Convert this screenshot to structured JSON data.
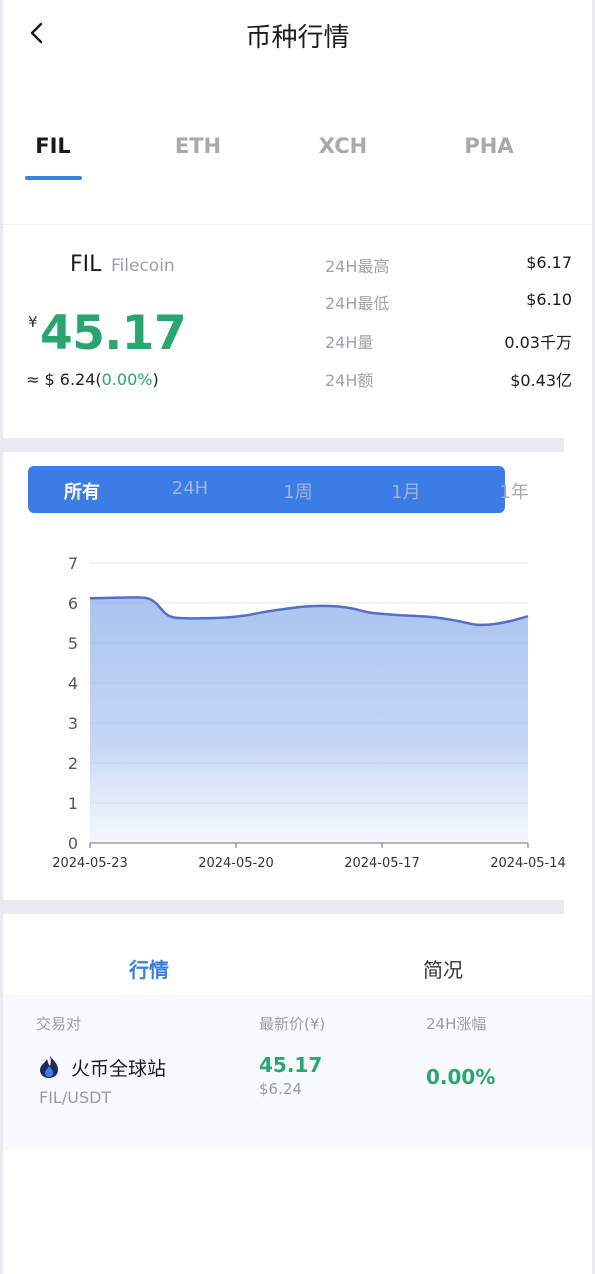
{
  "header": {
    "title": "币种行情"
  },
  "coin_tabs": [
    {
      "label": "FIL",
      "active": true
    },
    {
      "label": "ETH",
      "active": false
    },
    {
      "label": "XCH",
      "active": false
    },
    {
      "label": "PHA",
      "active": false
    }
  ],
  "coin": {
    "symbol": "FIL",
    "name": "Filecoin",
    "currency_mark": "¥",
    "price_cny": "45.17",
    "usd_prefix": "≈ $ 6.24(",
    "usd_change": "0.00%",
    "usd_suffix": ")"
  },
  "stats": [
    {
      "label": "24H最高",
      "value": "$6.17"
    },
    {
      "label": "24H最低",
      "value": "$6.10"
    },
    {
      "label": "24H量",
      "value": "0.03千万"
    },
    {
      "label": "24H额",
      "value": "$0.43亿"
    }
  ],
  "range_tabs": [
    {
      "label": "所有",
      "active": true
    },
    {
      "label": "24H",
      "active": false
    },
    {
      "label": "1周",
      "active": false
    },
    {
      "label": "1月",
      "active": false
    },
    {
      "label": "1年",
      "active": false
    }
  ],
  "chart_data": {
    "type": "area",
    "x": [
      "2024-05-23",
      "2024-05-20",
      "2024-05-17",
      "2024-05-14"
    ],
    "y_ticks": [
      0,
      1,
      2,
      3,
      4,
      5,
      6,
      7
    ],
    "ylim": [
      0,
      7
    ],
    "series": [
      {
        "points": [
          [
            0,
            6.12
          ],
          [
            0.05,
            6.13
          ],
          [
            0.1,
            6.14
          ],
          [
            0.13,
            6.12
          ],
          [
            0.15,
            6.0
          ],
          [
            0.18,
            5.68
          ],
          [
            0.22,
            5.62
          ],
          [
            0.3,
            5.63
          ],
          [
            0.35,
            5.68
          ],
          [
            0.4,
            5.78
          ],
          [
            0.45,
            5.86
          ],
          [
            0.5,
            5.92
          ],
          [
            0.56,
            5.92
          ],
          [
            0.6,
            5.86
          ],
          [
            0.64,
            5.76
          ],
          [
            0.7,
            5.7
          ],
          [
            0.78,
            5.65
          ],
          [
            0.84,
            5.55
          ],
          [
            0.88,
            5.46
          ],
          [
            0.92,
            5.47
          ],
          [
            0.96,
            5.55
          ],
          [
            1.0,
            5.67
          ]
        ]
      }
    ],
    "grid": true,
    "line_color": "#5470c6",
    "fill_color": "#8db0ea"
  },
  "bottom_tabs": [
    {
      "label": "行情",
      "active": true
    },
    {
      "label": "简况",
      "active": false
    }
  ],
  "market_table": {
    "headers": [
      "交易对",
      "最新价(¥)",
      "24H涨幅"
    ],
    "rows": [
      {
        "exchange": "火币全球站",
        "pair": "FIL/USDT",
        "price_cny": "45.17",
        "price_usd": "$6.24",
        "change": "0.00%"
      }
    ]
  }
}
